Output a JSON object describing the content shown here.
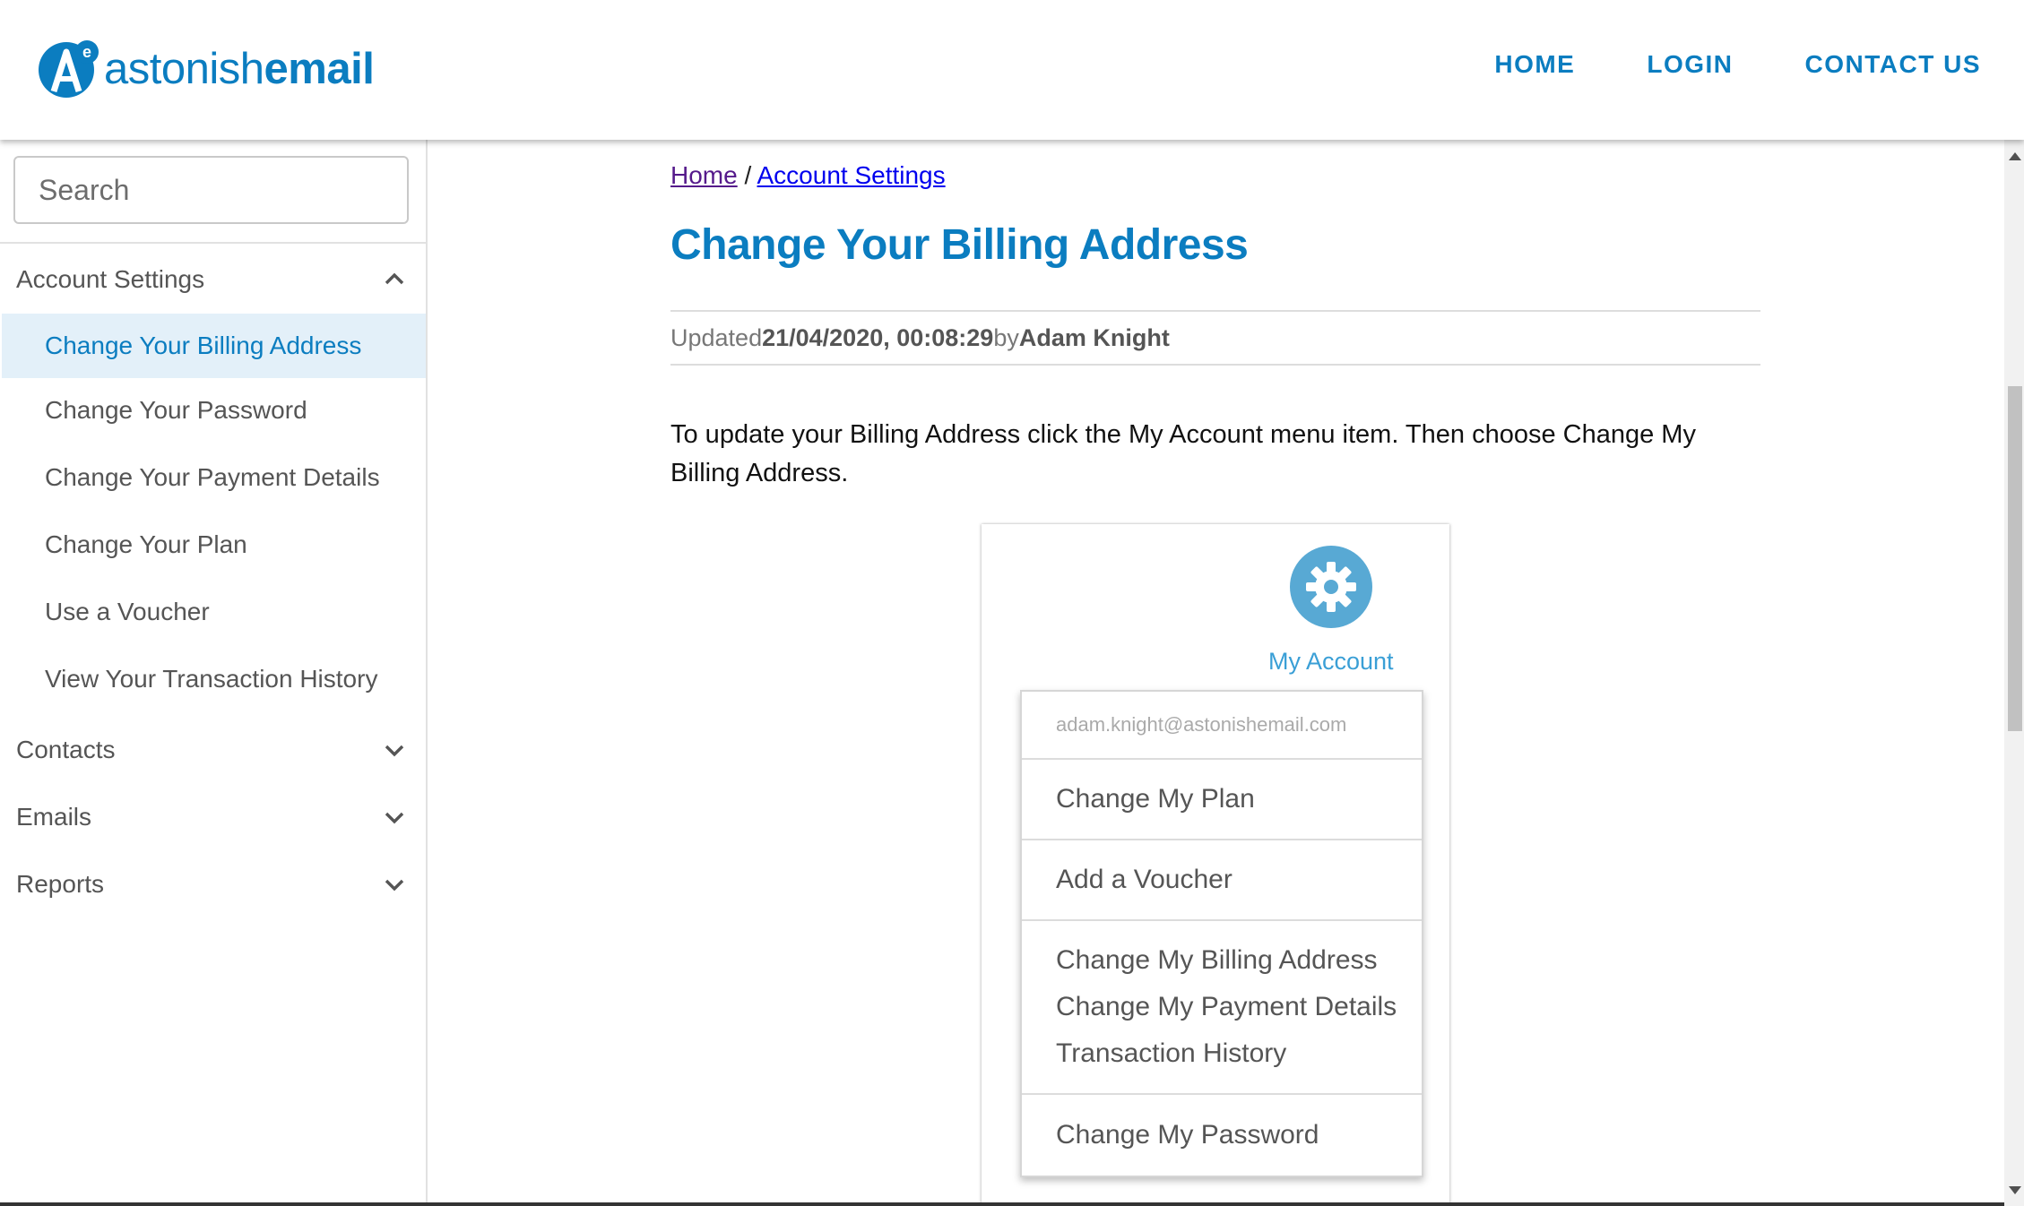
{
  "brand": {
    "name_thin": "astonish",
    "name_bold": "email",
    "accent_color": "#0b7dc0"
  },
  "nav": [
    {
      "label": "HOME"
    },
    {
      "label": "LOGIN"
    },
    {
      "label": "CONTACT US"
    }
  ],
  "sidebar": {
    "search_placeholder": "Search",
    "sections": [
      {
        "label": "Account Settings",
        "expanded": true,
        "items": [
          {
            "label": "Change Your Billing Address",
            "active": true
          },
          {
            "label": "Change Your Password"
          },
          {
            "label": "Change Your Payment Details"
          },
          {
            "label": "Change Your Plan"
          },
          {
            "label": "Use a Voucher"
          },
          {
            "label": "View Your Transaction History"
          }
        ]
      },
      {
        "label": "Contacts",
        "expanded": false
      },
      {
        "label": "Emails",
        "expanded": false
      },
      {
        "label": "Reports",
        "expanded": false
      }
    ]
  },
  "breadcrumb": {
    "home": "Home",
    "separator": "/",
    "current": "Account Settings"
  },
  "article": {
    "title": "Change Your Billing Address",
    "updated_prefix": "Updated",
    "updated_date": "21/04/2020, 00:08:29",
    "by": "by",
    "author": "Adam Knight",
    "body": "To update your Billing Address click the My Account menu item. Then choose Change My Billing Address."
  },
  "screenshot": {
    "icon": "gear-icon",
    "label": "My Account",
    "email": "adam.knight@astonishemail.com",
    "items": {
      "change_plan": "Change My Plan",
      "add_voucher": "Add a Voucher",
      "billing": "Change My Billing Address",
      "payment": "Change My Payment Details",
      "history": "Transaction History",
      "password": "Change My Password"
    }
  }
}
